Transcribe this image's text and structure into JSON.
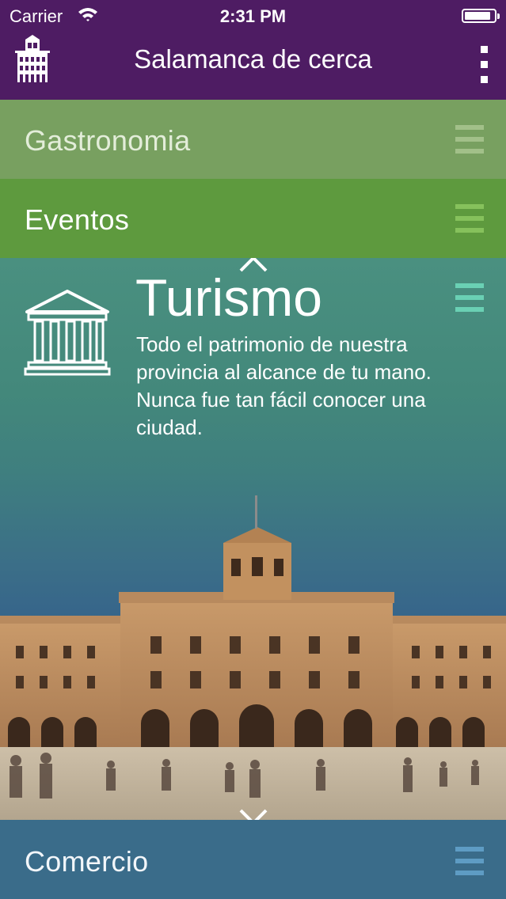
{
  "status_bar": {
    "carrier": "Carrier",
    "time": "2:31 PM",
    "battery_level": 0.9
  },
  "nav": {
    "title": "Salamanca de cerca",
    "logo_icon": "building-logo-icon",
    "menu_icon": "more-vertical-icon"
  },
  "categories": {
    "gastronomia": {
      "label": "Gastronomia"
    },
    "eventos": {
      "label": "Eventos"
    },
    "comercio": {
      "label": "Comercio"
    }
  },
  "turismo": {
    "title": "Turismo",
    "description": "Todo el patrimonio de nuestra provincia al alcance de tu mano. Nunca fue tan fácil conocer una ciudad.",
    "icon": "temple-icon"
  },
  "colors": {
    "nav_bg": "#4e1c63",
    "gastronomia_bg": "#78a060",
    "eventos_bg": "#5e9a3e",
    "turismo_accent": "#6ad0b4",
    "comercio_bg": "#3c6e8c"
  }
}
